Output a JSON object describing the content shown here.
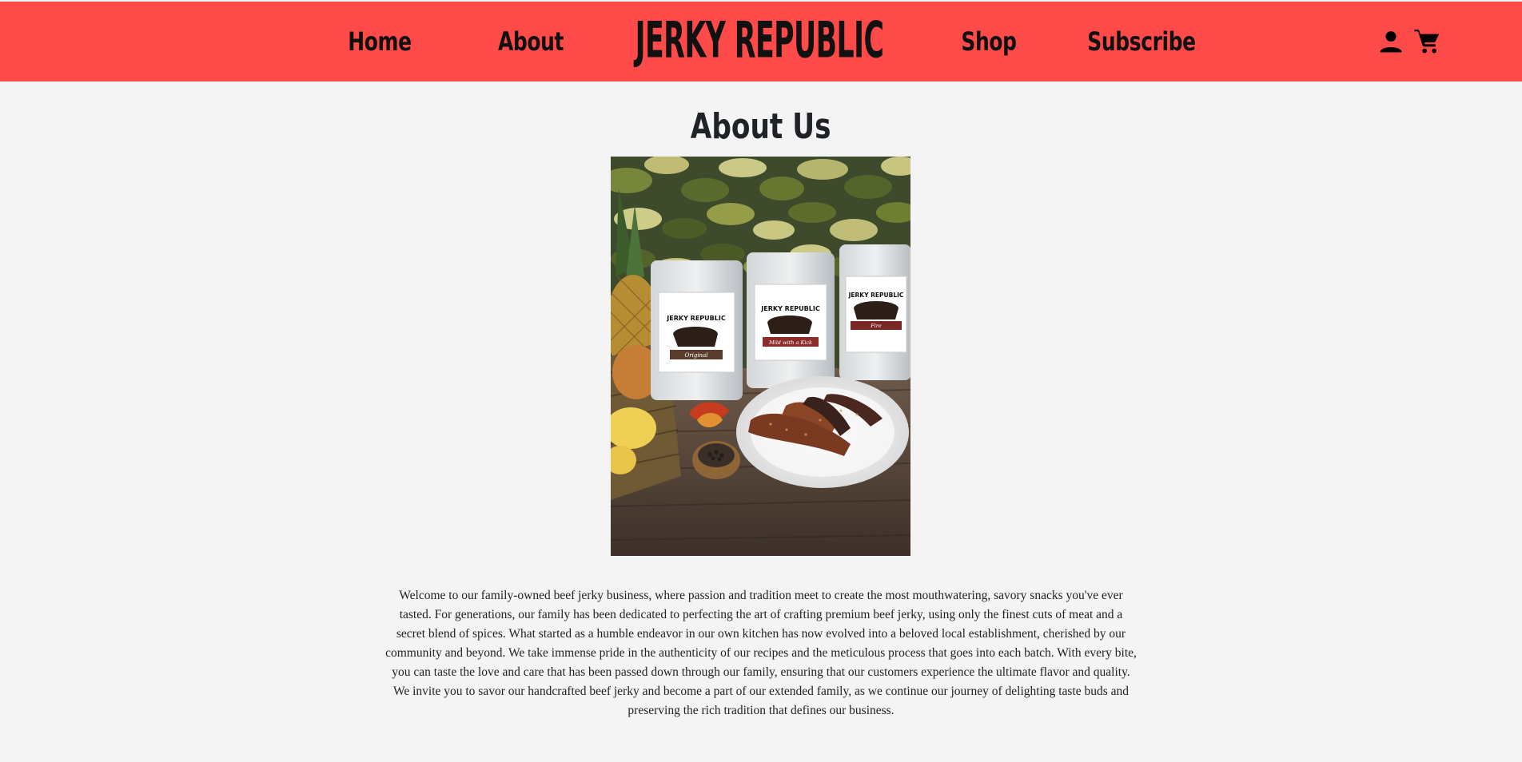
{
  "nav": {
    "home_label": "Home",
    "about_label": "About",
    "shop_label": "Shop",
    "subscribe_label": "Subscribe"
  },
  "brand": {
    "name": "JERKY REPUBLIC"
  },
  "header_icons": {
    "account": "person-icon",
    "cart": "cart-icon"
  },
  "main": {
    "title": "About Us",
    "body": "Welcome to our family-owned beef jerky business, where passion and tradition meet to create the most mouthwatering, savory snacks you've ever tasted. For generations, our family has been dedicated to perfecting the art of crafting premium beef jerky, using only the finest cuts of meat and a secret blend of spices. What started as a humble endeavor in our own kitchen has now evolved into a beloved local establishment, cherished by our community and beyond. We take immense pride in the authenticity of our recipes and the meticulous process that goes into each batch. With every bite, you can taste the love and care that has been passed down through our family, ensuring that our customers experience the ultimate flavor and quality. We invite you to savor our handcrafted beef jerky and become a part of our extended family, as we continue our journey of delighting taste buds and preserving the rich tradition that defines our business."
  },
  "photo": {
    "bag_labels": [
      "Original",
      "Mild with a Kick",
      "Fire"
    ]
  },
  "colors": {
    "header_bg": "#ff4a4a",
    "page_bg": "#f4f4f4",
    "text": "#111111"
  }
}
